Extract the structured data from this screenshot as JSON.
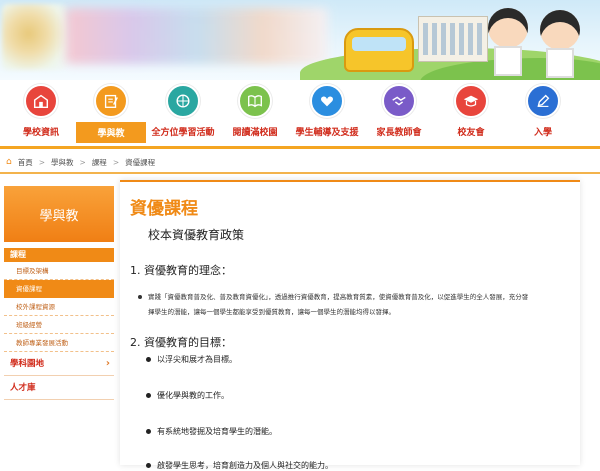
{
  "nav": {
    "items": [
      {
        "label": "學校資訊",
        "color": "#e8453c",
        "icon": "school-icon"
      },
      {
        "label": "學與教",
        "color": "#f39a1e",
        "icon": "pencil-note-icon"
      },
      {
        "label": "全方位學習活動",
        "color": "#2aa7a1",
        "icon": "basketball-icon"
      },
      {
        "label": "閱讀滿校園",
        "color": "#7cc24d",
        "icon": "book-icon"
      },
      {
        "label": "學生輔導及支援",
        "color": "#2b8ee0",
        "icon": "heart-icon"
      },
      {
        "label": "家長教師會",
        "color": "#7a5bc8",
        "icon": "handshake-icon"
      },
      {
        "label": "校友會",
        "color": "#e8453c",
        "icon": "graduation-cap-icon"
      },
      {
        "label": "入學",
        "color": "#2b6fd4",
        "icon": "pen-icon"
      }
    ],
    "active_index": 1
  },
  "breadcrumb": {
    "items": [
      "首頁",
      "學與教",
      "課程",
      "資優課程"
    ],
    "separator": ">"
  },
  "sidebar": {
    "header": "學與教",
    "section": "課程",
    "sub_items": [
      "目標及架構",
      "資優課程",
      "校外課程資源",
      "班級經營",
      "教師專業發展活動"
    ],
    "active_sub": "資優課程",
    "big_items": [
      "學科園地",
      "人才庫"
    ]
  },
  "content": {
    "title": "資優課程",
    "policy_heading": "校本資優教育政策",
    "section1": "1. 資優教育的理念：",
    "para1_line1": "實踐「資優教育普及化、普及教育資優化」，透過推行資優教育，提高教育質素，使資優教育普及化，以促進學生的全人發展，充分發",
    "para1_line2": "揮學生的潛能，讓每一個學生都能享受到優質教育，讓每一個學生的潛能均得以發揮。",
    "section2": "2. 資優教育的目標：",
    "goals": [
      "以浮尖和展才為目標。",
      "優化學與教的工作。",
      "有系統地發掘及培育學生的潛能。",
      "啟發學生思考，培育創造力及個人與社交的能力。"
    ]
  },
  "colors": {
    "accent": "#f08a16",
    "nav_text": "#d12d1d"
  }
}
